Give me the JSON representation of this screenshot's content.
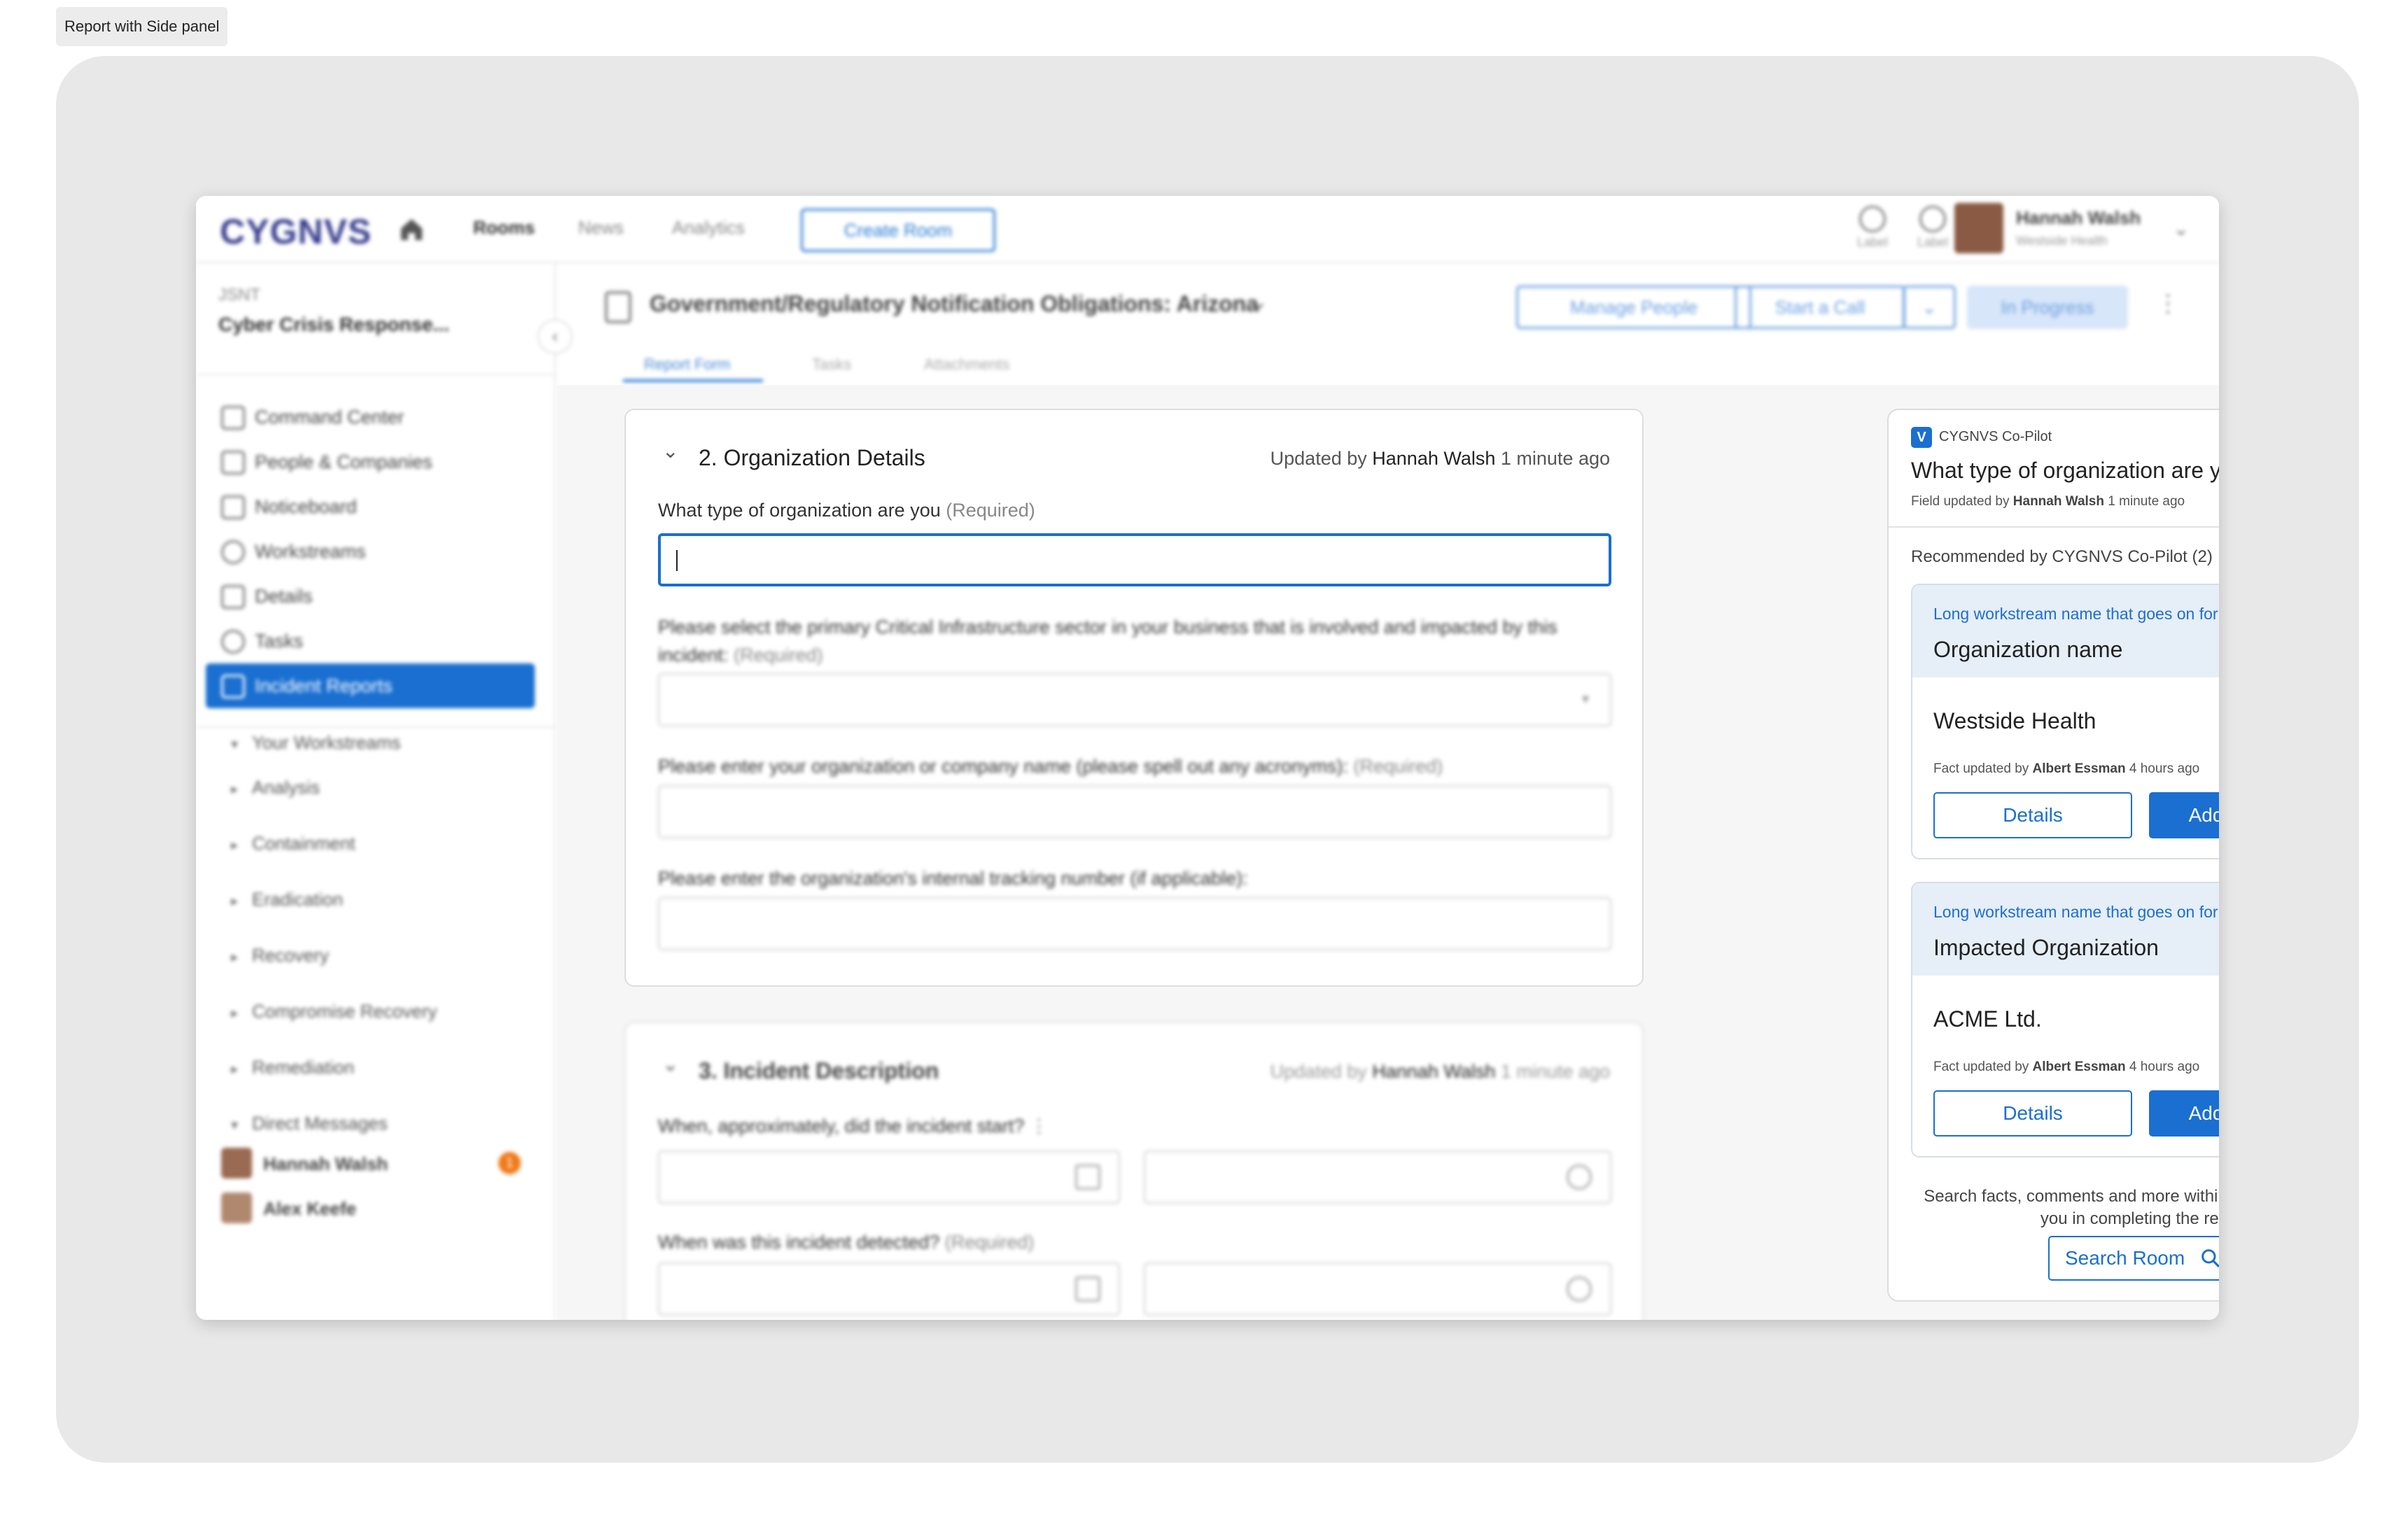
{
  "canvas_label": "Report with Side panel",
  "topbar": {
    "logo": "CYGNVS",
    "nav": [
      "Rooms",
      "News",
      "Analytics"
    ],
    "create_room": "Create Room",
    "icon_labels": [
      "Label",
      "Label"
    ],
    "user": {
      "name": "Hannah Walsh",
      "org": "Westside Health"
    }
  },
  "sidebar": {
    "room_code": "JSNT",
    "room_name": "Cyber Crisis Response...",
    "items": [
      {
        "label": "Command Center",
        "icon": "building-icon"
      },
      {
        "label": "People & Companies",
        "icon": "people-icon"
      },
      {
        "label": "Noticeboard",
        "icon": "megaphone-icon"
      },
      {
        "label": "Workstreams",
        "icon": "circle-icon"
      },
      {
        "label": "Details",
        "icon": "details-icon"
      },
      {
        "label": "Tasks",
        "icon": "check-circle-icon"
      },
      {
        "label": "Incident Reports",
        "icon": "report-icon"
      }
    ],
    "your_workstreams": "Your Workstreams",
    "workstreams": [
      "Analysis",
      "Containment",
      "Eradication",
      "Recovery",
      "Compromise Recovery",
      "Remediation"
    ],
    "direct_messages": "Direct Messages",
    "dms": [
      {
        "name": "Hannah Walsh",
        "badge": "1"
      },
      {
        "name": "Alex Keefe"
      }
    ]
  },
  "header": {
    "title": "Government/Regulatory Notification Obligations: Arizona",
    "manage_people": "Manage People",
    "start_call": "Start a Call",
    "status": "In Progress",
    "tabs": [
      "Report Form",
      "Tasks",
      "Attachments"
    ]
  },
  "form": {
    "section2": {
      "title": "2. Organization Details",
      "updated_prefix": "Updated by",
      "updated_by": "Hannah Walsh",
      "updated_when": "1 minute ago",
      "q1": "What type of organization are you",
      "q2": "Please select the primary Critical Infrastructure sector in your business that is involved and impacted by this incident:",
      "q3": "Please enter your organization or company name (please spell out any acronyms):",
      "q4": "Please enter the organization's internal tracking number (if applicable):",
      "required": "(Required)"
    },
    "section3": {
      "title": "3. Incident Description",
      "updated_prefix": "Updated by",
      "updated_by": "Hannah Walsh",
      "updated_when": "1 minute ago",
      "q1": "When, approximately, did the incident start?",
      "q2": "When was this incident detected?",
      "required": "(Required)"
    }
  },
  "copilot": {
    "brand": "CYGNVS Co-Pilot",
    "question": "What type of organization are you",
    "field_updated_prefix": "Field updated by",
    "field_updated_by": "Hannah Walsh",
    "field_updated_when": "1 minute ago",
    "recommended": "Recommended by CYGNVS Co-Pilot (2)",
    "cards": [
      {
        "workstream": "Long workstream name that goes on for a w...",
        "field": "Organization name",
        "value": "Westside Health",
        "updated_prefix": "Fact updated by",
        "updated_by": "Albert Essman",
        "updated_when": "4 hours ago",
        "details": "Details",
        "add": "Add to Report"
      },
      {
        "workstream": "Long workstream name that goes on for a w...",
        "field": "Impacted Organization",
        "value": "ACME Ltd.",
        "updated_prefix": "Fact updated by",
        "updated_by": "Albert Essman",
        "updated_when": "4 hours ago",
        "details": "Details",
        "add": "Add to Report"
      }
    ],
    "help": "Search facts, comments and more within the room to assist you in completing the report",
    "search_room": "Search Room"
  },
  "colors": {
    "primary": "#1a6fd1",
    "badge": "#f07a1a"
  }
}
